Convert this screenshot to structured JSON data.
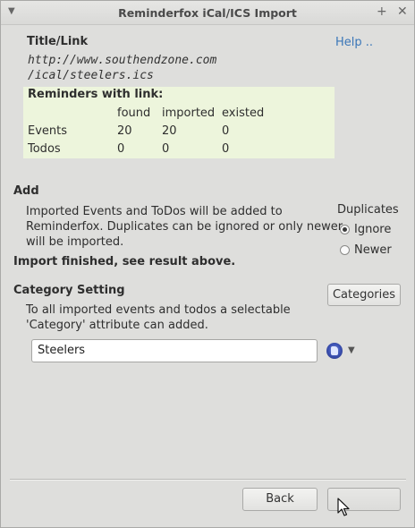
{
  "window": {
    "title": "Reminderfox iCal/ICS Import"
  },
  "title_link": {
    "heading": "Title/Link",
    "help_link": "Help ..",
    "url_line1": "http://www.southendzone.com",
    "url_line2": "/ical/steelers.ics"
  },
  "reminders": {
    "heading": "Reminders with link:",
    "columns": [
      "found",
      "imported",
      "existed"
    ],
    "rows": [
      {
        "label": "Events",
        "values": [
          "20",
          "20",
          "0"
        ]
      },
      {
        "label": "Todos",
        "values": [
          "0",
          "0",
          "0"
        ]
      }
    ]
  },
  "add": {
    "heading": "Add",
    "desc_line1": "Imported Events and ToDos will be added to",
    "desc_line2": "Reminderfox. Duplicates can be ignored or only newer",
    "desc_line3": "will be imported.",
    "status": "Import finished, see result above."
  },
  "duplicates": {
    "label": "Duplicates",
    "options": [
      {
        "label": "Ignore",
        "selected": true
      },
      {
        "label": "Newer",
        "selected": false
      }
    ]
  },
  "category": {
    "heading": "Category Setting",
    "button_label": "Categories",
    "desc_line1": "To all imported events and todos a selectable",
    "desc_line2": "'Category' attribute can added.",
    "value": "Steelers"
  },
  "footer": {
    "back_label": "Back",
    "finish_label": ""
  }
}
